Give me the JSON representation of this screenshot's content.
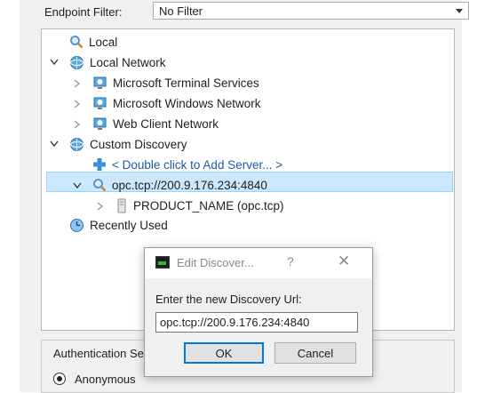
{
  "filter": {
    "label": "Endpoint Filter:",
    "value": "No Filter"
  },
  "tree": {
    "local": "Local",
    "local_network": "Local Network",
    "terminal_services": "Microsoft Terminal Services",
    "windows_network": "Microsoft Windows Network",
    "web_client": "Web Client Network",
    "custom_discovery": "Custom Discovery",
    "add_server": "< Double click to Add Server... >",
    "discovery_url": "opc.tcp://200.9.176.234:4840",
    "product": "PRODUCT_NAME (opc.tcp)",
    "recently_used": "Recently Used"
  },
  "auth": {
    "title": "Authentication Se",
    "option": "Anonymous"
  },
  "dialog": {
    "title": "Edit Discover...",
    "help": "?",
    "close": "✕",
    "prompt": "Enter the new Discovery Url:",
    "input_value": "opc.tcp://200.9.176.234:4840",
    "ok": "OK",
    "cancel": "Cancel"
  },
  "colors": {
    "selection": "#cce8ff",
    "link": "#1a5aa8",
    "accent": "#0078d7"
  },
  "icons": [
    "search-icon",
    "globe-icon",
    "computer-globe-icon",
    "plus-icon",
    "server-icon",
    "clock-globe-icon",
    "app-icon",
    "close-icon"
  ]
}
